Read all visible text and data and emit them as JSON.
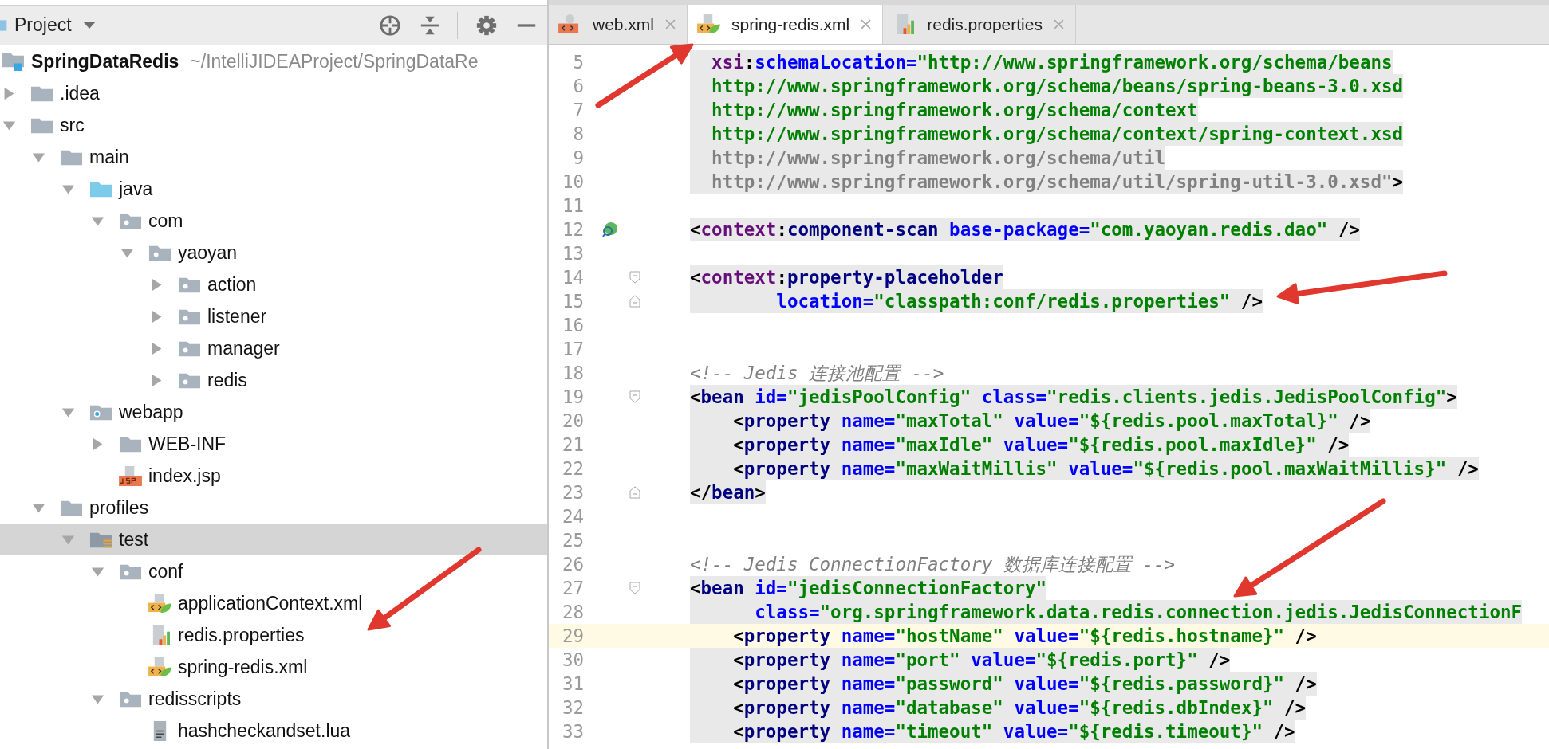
{
  "project_panel": {
    "title": "Project",
    "root": {
      "name": "SpringDataRedis",
      "path": "~/IntelliJIDEAProject/SpringDataRe",
      "selected": false
    },
    "items": [
      {
        "name": ".idea",
        "kind": "folder",
        "expanded": false,
        "selected": false
      },
      {
        "name": "src",
        "kind": "folder",
        "expanded": true,
        "selected": false,
        "children": [
          {
            "name": "main",
            "kind": "folder",
            "expanded": true,
            "selected": false,
            "children": [
              {
                "name": "java",
                "kind": "source-folder",
                "expanded": true,
                "selected": false,
                "children": [
                  {
                    "name": "com",
                    "kind": "package",
                    "expanded": true,
                    "selected": false,
                    "children": [
                      {
                        "name": "yaoyan",
                        "kind": "package",
                        "expanded": true,
                        "selected": false,
                        "children": [
                          {
                            "name": "action",
                            "kind": "package",
                            "expanded": false,
                            "selected": false
                          },
                          {
                            "name": "listener",
                            "kind": "package",
                            "expanded": false,
                            "selected": false
                          },
                          {
                            "name": "manager",
                            "kind": "package",
                            "expanded": false,
                            "selected": false
                          },
                          {
                            "name": "redis",
                            "kind": "package",
                            "expanded": false,
                            "selected": false
                          }
                        ]
                      }
                    ]
                  }
                ]
              },
              {
                "name": "webapp",
                "kind": "web-folder",
                "expanded": true,
                "selected": false,
                "children": [
                  {
                    "name": "WEB-INF",
                    "kind": "folder",
                    "expanded": false,
                    "selected": false
                  },
                  {
                    "name": "index.jsp",
                    "kind": "jsp",
                    "selected": false
                  }
                ]
              }
            ]
          },
          {
            "name": "profiles",
            "kind": "folder",
            "expanded": true,
            "selected": false,
            "children": [
              {
                "name": "test",
                "kind": "resource-folder",
                "expanded": true,
                "selected": true,
                "children": [
                  {
                    "name": "conf",
                    "kind": "package",
                    "expanded": true,
                    "selected": false,
                    "children": [
                      {
                        "name": "applicationContext.xml",
                        "kind": "spring-xml",
                        "selected": false
                      },
                      {
                        "name": "redis.properties",
                        "kind": "properties",
                        "selected": false
                      },
                      {
                        "name": "spring-redis.xml",
                        "kind": "spring-xml",
                        "selected": false
                      }
                    ]
                  },
                  {
                    "name": "redisscripts",
                    "kind": "package",
                    "expanded": true,
                    "selected": false,
                    "children": [
                      {
                        "name": "hashcheckandset.lua",
                        "kind": "text",
                        "selected": false
                      }
                    ]
                  }
                ]
              }
            ]
          }
        ]
      }
    ]
  },
  "tabs": [
    {
      "label": "web.xml",
      "kind": "xml",
      "selected": false
    },
    {
      "label": "spring-redis.xml",
      "kind": "spring-xml",
      "selected": true
    },
    {
      "label": "redis.properties",
      "kind": "properties",
      "selected": false
    }
  ],
  "editor": {
    "lines": [
      {
        "number": "5",
        "shaded": true,
        "current": false,
        "bean_marker": false,
        "fold_start": false,
        "fold_end": false,
        "tokens": [
          {
            "kind": "ns",
            "text": "  xsi"
          },
          {
            "kind": "punct",
            "text": ":"
          },
          {
            "kind": "attr",
            "text": "schemaLocation="
          },
          {
            "kind": "value",
            "text": "\"http://www.springframework.org/schema/beans"
          }
        ]
      },
      {
        "number": "6",
        "shaded": true,
        "current": false,
        "bean_marker": false,
        "fold_start": false,
        "fold_end": false,
        "tokens": [
          {
            "kind": "value",
            "text": "  http://www.springframework.org/schema/beans/spring-beans-3.0.xsd"
          }
        ]
      },
      {
        "number": "7",
        "shaded": true,
        "current": false,
        "bean_marker": false,
        "fold_start": false,
        "fold_end": false,
        "tokens": [
          {
            "kind": "value",
            "text": "  http://www.springframework.org/schema/context"
          }
        ]
      },
      {
        "number": "8",
        "shaded": true,
        "current": false,
        "bean_marker": false,
        "fold_start": false,
        "fold_end": false,
        "tokens": [
          {
            "kind": "value",
            "text": "  http://www.springframework.org/schema/context/spring-context.xsd"
          }
        ]
      },
      {
        "number": "9",
        "shaded": true,
        "current": false,
        "bean_marker": false,
        "fold_start": false,
        "fold_end": false,
        "tokens": [
          {
            "kind": "unused",
            "text": "  http://www.springframework.org/schema/util"
          }
        ]
      },
      {
        "number": "10",
        "shaded": true,
        "current": false,
        "bean_marker": false,
        "fold_start": false,
        "fold_end": false,
        "tokens": [
          {
            "kind": "unused",
            "text": "  http://www.springframework.org/schema/util/spring-util-3.0.xsd\""
          },
          {
            "kind": "punct",
            "text": ">"
          }
        ]
      },
      {
        "number": "11",
        "shaded": false,
        "current": false,
        "bean_marker": false,
        "fold_start": false,
        "fold_end": false
      },
      {
        "number": "12",
        "shaded": true,
        "current": false,
        "bean_marker": true,
        "fold_start": false,
        "fold_end": false,
        "tokens": [
          {
            "kind": "punct",
            "text": "<"
          },
          {
            "kind": "ns",
            "text": "context"
          },
          {
            "kind": "punct",
            "text": ":"
          },
          {
            "kind": "tag",
            "text": "component-scan"
          },
          {
            "kind": "attr",
            "text": " base-package="
          },
          {
            "kind": "value",
            "text": "\"com.yaoyan.redis.dao\""
          },
          {
            "kind": "punct",
            "text": " />"
          }
        ]
      },
      {
        "number": "13",
        "shaded": false,
        "current": false,
        "bean_marker": false,
        "fold_start": false,
        "fold_end": false
      },
      {
        "number": "14",
        "shaded": true,
        "current": false,
        "bean_marker": false,
        "fold_start": true,
        "fold_end": false,
        "tokens": [
          {
            "kind": "punct",
            "text": "<"
          },
          {
            "kind": "ns",
            "text": "context"
          },
          {
            "kind": "punct",
            "text": ":"
          },
          {
            "kind": "tag",
            "text": "property-placeholder"
          }
        ]
      },
      {
        "number": "15",
        "shaded": true,
        "current": false,
        "bean_marker": false,
        "fold_start": false,
        "fold_end": true,
        "tokens": [
          {
            "kind": "attr",
            "text": "        location="
          },
          {
            "kind": "value",
            "text": "\"classpath:conf/redis.properties\""
          },
          {
            "kind": "punct",
            "text": " />"
          }
        ]
      },
      {
        "number": "16",
        "shaded": false,
        "current": false,
        "bean_marker": false,
        "fold_start": false,
        "fold_end": false
      },
      {
        "number": "17",
        "shaded": false,
        "current": false,
        "bean_marker": false,
        "fold_start": false,
        "fold_end": false
      },
      {
        "number": "18",
        "shaded": false,
        "current": false,
        "bean_marker": false,
        "fold_start": false,
        "fold_end": false,
        "tokens": [
          {
            "kind": "comment",
            "text": "<!-- Jedis 连接池配置 -->"
          }
        ]
      },
      {
        "number": "19",
        "shaded": true,
        "current": false,
        "bean_marker": false,
        "fold_start": true,
        "fold_end": false,
        "tokens": [
          {
            "kind": "punct",
            "text": "<"
          },
          {
            "kind": "tag",
            "text": "bean"
          },
          {
            "kind": "attr",
            "text": " id="
          },
          {
            "kind": "value",
            "text": "\"jedisPoolConfig\""
          },
          {
            "kind": "attr",
            "text": " class="
          },
          {
            "kind": "value",
            "text": "\"redis.clients.jedis.JedisPoolConfig\""
          },
          {
            "kind": "punct",
            "text": ">"
          }
        ]
      },
      {
        "number": "20",
        "shaded": true,
        "current": false,
        "bean_marker": false,
        "fold_start": false,
        "fold_end": false,
        "tokens": [
          {
            "kind": "punct",
            "text": "    <"
          },
          {
            "kind": "tag",
            "text": "property"
          },
          {
            "kind": "attr",
            "text": " name="
          },
          {
            "kind": "value",
            "text": "\"maxTotal\""
          },
          {
            "kind": "attr",
            "text": " value="
          },
          {
            "kind": "value",
            "text": "\"${redis.pool.maxTotal}\""
          },
          {
            "kind": "punct",
            "text": " />"
          }
        ]
      },
      {
        "number": "21",
        "shaded": true,
        "current": false,
        "bean_marker": false,
        "fold_start": false,
        "fold_end": false,
        "tokens": [
          {
            "kind": "punct",
            "text": "    <"
          },
          {
            "kind": "tag",
            "text": "property"
          },
          {
            "kind": "attr",
            "text": " name="
          },
          {
            "kind": "value",
            "text": "\"maxIdle\""
          },
          {
            "kind": "attr",
            "text": " value="
          },
          {
            "kind": "value",
            "text": "\"${redis.pool.maxIdle}\""
          },
          {
            "kind": "punct",
            "text": " />"
          }
        ]
      },
      {
        "number": "22",
        "shaded": true,
        "current": false,
        "bean_marker": false,
        "fold_start": false,
        "fold_end": false,
        "tokens": [
          {
            "kind": "punct",
            "text": "    <"
          },
          {
            "kind": "tag",
            "text": "property"
          },
          {
            "kind": "attr",
            "text": " name="
          },
          {
            "kind": "value",
            "text": "\"maxWaitMillis\""
          },
          {
            "kind": "attr",
            "text": " value="
          },
          {
            "kind": "value",
            "text": "\"${redis.pool.maxWaitMillis}\""
          },
          {
            "kind": "punct",
            "text": " />"
          }
        ]
      },
      {
        "number": "23",
        "shaded": true,
        "current": false,
        "bean_marker": false,
        "fold_start": false,
        "fold_end": true,
        "tokens": [
          {
            "kind": "punct",
            "text": "</"
          },
          {
            "kind": "tag",
            "text": "bean"
          },
          {
            "kind": "punct",
            "text": ">"
          }
        ]
      },
      {
        "number": "24",
        "shaded": false,
        "current": false,
        "bean_marker": false,
        "fold_start": false,
        "fold_end": false
      },
      {
        "number": "25",
        "shaded": false,
        "current": false,
        "bean_marker": false,
        "fold_start": false,
        "fold_end": false
      },
      {
        "number": "26",
        "shaded": false,
        "current": false,
        "bean_marker": false,
        "fold_start": false,
        "fold_end": false,
        "tokens": [
          {
            "kind": "comment",
            "text": "<!-- Jedis ConnectionFactory 数据库连接配置 -->"
          }
        ]
      },
      {
        "number": "27",
        "shaded": true,
        "current": false,
        "bean_marker": false,
        "fold_start": true,
        "fold_end": false,
        "tokens": [
          {
            "kind": "punct",
            "text": "<"
          },
          {
            "kind": "tag",
            "text": "bean"
          },
          {
            "kind": "attr",
            "text": " id="
          },
          {
            "kind": "value",
            "text": "\"jedisConnectionFactory\""
          }
        ]
      },
      {
        "number": "28",
        "shaded": true,
        "current": false,
        "bean_marker": false,
        "fold_start": false,
        "fold_end": false,
        "tokens": [
          {
            "kind": "attr",
            "text": "      class="
          },
          {
            "kind": "value",
            "text": "\"org.springframework.data.redis.connection.jedis.JedisConnectionF"
          }
        ]
      },
      {
        "number": "29",
        "shaded": false,
        "current": true,
        "bean_marker": false,
        "fold_start": false,
        "fold_end": false,
        "tokens": [
          {
            "kind": "punct",
            "text": "    <"
          },
          {
            "kind": "tag",
            "text": "property"
          },
          {
            "kind": "attr",
            "text": " name="
          },
          {
            "kind": "value",
            "text": "\"hostName\""
          },
          {
            "kind": "attr",
            "text": " value="
          },
          {
            "kind": "value",
            "text": "\"${redis.hostname}\""
          },
          {
            "kind": "punct",
            "text": " />"
          }
        ]
      },
      {
        "number": "30",
        "shaded": true,
        "current": false,
        "bean_marker": false,
        "fold_start": false,
        "fold_end": false,
        "tokens": [
          {
            "kind": "punct",
            "text": "    <"
          },
          {
            "kind": "tag",
            "text": "property"
          },
          {
            "kind": "attr",
            "text": " name="
          },
          {
            "kind": "value",
            "text": "\"port\""
          },
          {
            "kind": "attr",
            "text": " value="
          },
          {
            "kind": "value",
            "text": "\"${redis.port}\""
          },
          {
            "kind": "punct",
            "text": " />"
          }
        ]
      },
      {
        "number": "31",
        "shaded": true,
        "current": false,
        "bean_marker": false,
        "fold_start": false,
        "fold_end": false,
        "tokens": [
          {
            "kind": "punct",
            "text": "    <"
          },
          {
            "kind": "tag",
            "text": "property"
          },
          {
            "kind": "attr",
            "text": " name="
          },
          {
            "kind": "value",
            "text": "\"password\""
          },
          {
            "kind": "attr",
            "text": " value="
          },
          {
            "kind": "value",
            "text": "\"${redis.password}\""
          },
          {
            "kind": "punct",
            "text": " />"
          }
        ]
      },
      {
        "number": "32",
        "shaded": true,
        "current": false,
        "bean_marker": false,
        "fold_start": false,
        "fold_end": false,
        "tokens": [
          {
            "kind": "punct",
            "text": "    <"
          },
          {
            "kind": "tag",
            "text": "property"
          },
          {
            "kind": "attr",
            "text": " name="
          },
          {
            "kind": "value",
            "text": "\"database\""
          },
          {
            "kind": "attr",
            "text": " value="
          },
          {
            "kind": "value",
            "text": "\"${redis.dbIndex}\""
          },
          {
            "kind": "punct",
            "text": " />"
          }
        ]
      },
      {
        "number": "33",
        "shaded": true,
        "current": false,
        "bean_marker": false,
        "fold_start": false,
        "fold_end": false,
        "tokens": [
          {
            "kind": "punct",
            "text": "    <"
          },
          {
            "kind": "tag",
            "text": "property"
          },
          {
            "kind": "attr",
            "text": " name="
          },
          {
            "kind": "value",
            "text": "\"timeout\""
          },
          {
            "kind": "attr",
            "text": " value="
          },
          {
            "kind": "value",
            "text": "\"${redis.timeout}\""
          },
          {
            "kind": "punct",
            "text": " />"
          }
        ]
      }
    ]
  }
}
